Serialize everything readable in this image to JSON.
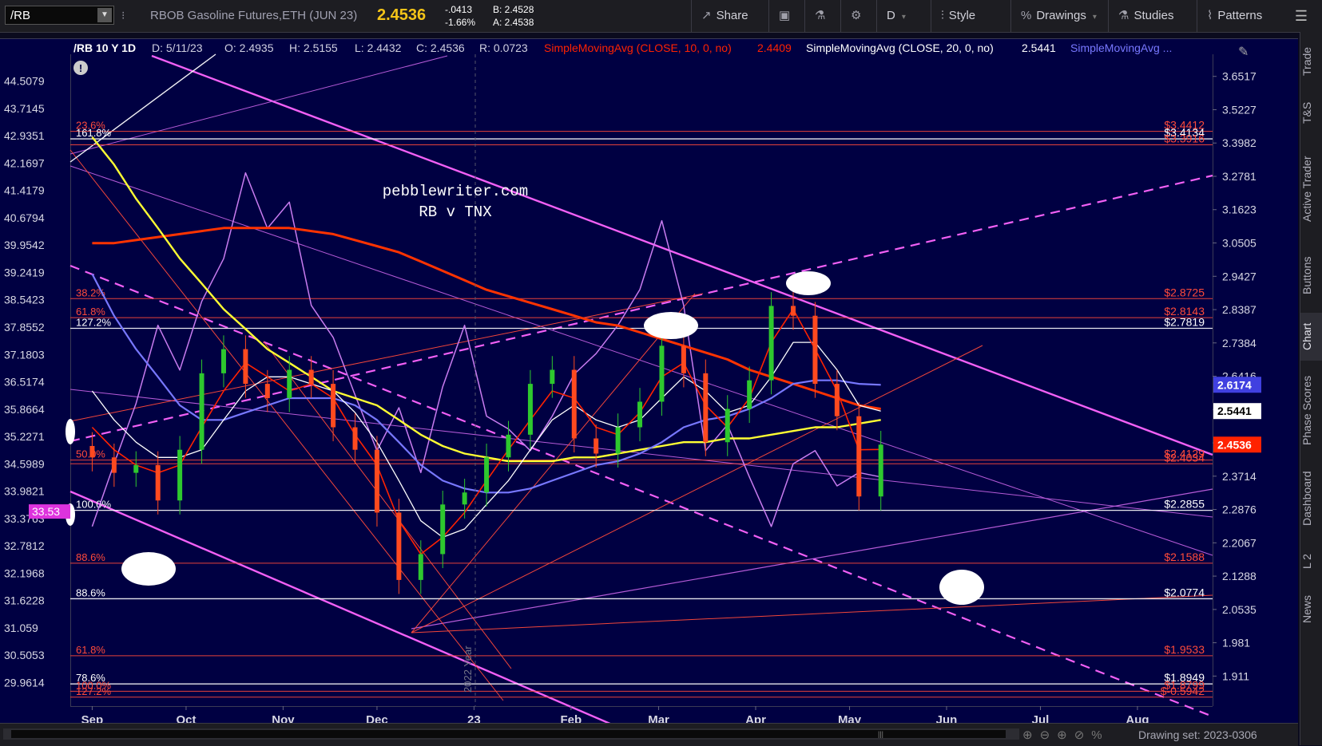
{
  "toolbar": {
    "symbol": "/RB",
    "description": "RBOB Gasoline Futures,ETH (JUN 23)",
    "last": "2.4536",
    "net_change": "-.0413",
    "pct_change": "-1.66%",
    "bid": "B: 2.4528",
    "ask": "A: 2.4538",
    "share": "Share",
    "period": "D",
    "style": "Style",
    "drawings": "Drawings",
    "studies": "Studies",
    "patterns": "Patterns"
  },
  "sidebar": {
    "tabs": [
      "Trade",
      "T&S",
      "Active Trader",
      "Buttons",
      "Chart",
      "Phase Scores",
      "Dashboard",
      "L 2",
      "News"
    ],
    "active": "Chart"
  },
  "bottombar": {
    "drawing_set": "Drawing set: 2023-0306"
  },
  "colors": {
    "background": "#000042",
    "candle_up": "#2ec82e",
    "candle_down": "#ff4a1f",
    "sma10": "#ff2200",
    "sma20": "#ffffff",
    "sma50": "#7878ff",
    "sma100": "#ffff33",
    "sma200": "#ff3300",
    "tnx": "#c87cf0",
    "fib_red": "#ff4a3a",
    "fib_white": "#ffffff",
    "channel": "#ff66ff"
  },
  "chart_data": {
    "type": "line",
    "header": {
      "title": "/RB 10 Y 1D",
      "date": "D: 5/11/23",
      "open": "O: 2.4935",
      "high": "H: 2.5155",
      "low": "L: 2.4432",
      "close": "C: 2.4536",
      "range": "R: 0.0723",
      "sma10_label": "SimpleMovingAvg (CLOSE, 10, 0, no)",
      "sma10_value": "2.4409",
      "sma20_label": "SimpleMovingAvg (CLOSE, 20, 0, no)",
      "sma20_value": "2.5441",
      "sma50_label": "SimpleMovingAvg ..."
    },
    "annotations": [
      "pebblewriter.com",
      "RB v TNX"
    ],
    "x_labels": [
      "Sep",
      "Oct",
      "Nov",
      "Dec",
      "23",
      "Feb",
      "Mar",
      "Apr",
      "May",
      "Jun",
      "Jul",
      "Aug"
    ],
    "year_marker": "2022 Year",
    "right_axis": {
      "ylim": [
        1.85,
        3.74
      ],
      "ticks": [
        "3.6517",
        "3.5227",
        "3.3982",
        "3.2781",
        "3.1623",
        "3.0505",
        "2.9427",
        "2.8387",
        "2.7384",
        "2.6416",
        "2.5483",
        "2.4583",
        "2.3714",
        "2.2876",
        "2.2067",
        "2.1288",
        "2.0535",
        "1.981",
        "1.911"
      ],
      "badges": [
        {
          "value": "2.6174",
          "color": "#4040e0"
        },
        {
          "value": "2.5441",
          "color": "#ffffff"
        },
        {
          "value": "2.4536",
          "color": "#ff2200"
        }
      ]
    },
    "left_axis": {
      "ylim": [
        29.5,
        45.3
      ],
      "ticks": [
        "44.5079",
        "43.7145",
        "42.9351",
        "42.1697",
        "41.4179",
        "40.6794",
        "39.9542",
        "39.2419",
        "38.5423",
        "37.8552",
        "37.1803",
        "36.5174",
        "35.8664",
        "35.2271",
        "34.5989",
        "33.9821",
        "33.3763",
        "32.7812",
        "32.1968",
        "31.6228",
        "31.059",
        "30.5053",
        "29.9614"
      ],
      "badge": "33.53"
    },
    "fib_levels": [
      {
        "value": 3.4412,
        "label": "$3.4412",
        "side_label": "23.6%",
        "color": "red"
      },
      {
        "value": 3.4134,
        "label": "$3.4134",
        "side_label": "161.8%",
        "color": "white"
      },
      {
        "value": 3.3916,
        "label": "$3.3916",
        "side_label": "",
        "color": "red"
      },
      {
        "value": 2.8725,
        "label": "$2.8725",
        "side_label": "38.2%",
        "color": "red"
      },
      {
        "value": 2.8143,
        "label": "$2.8143",
        "side_label": "61.8%",
        "color": "red"
      },
      {
        "value": 2.7819,
        "label": "$2.7819",
        "side_label": "127.2%",
        "color": "white"
      },
      {
        "value": 2.4129,
        "label": "$2.4129",
        "side_label": "50.0%",
        "color": "red"
      },
      {
        "value": 2.4034,
        "label": "$2.4034",
        "side_label": "",
        "color": "red"
      },
      {
        "value": 2.2855,
        "label": "$2.2855",
        "side_label": "100.0%",
        "color": "white"
      },
      {
        "value": 2.1588,
        "label": "$2.1588",
        "side_label": "88.6%",
        "color": "red"
      },
      {
        "value": 2.0774,
        "label": "$2.0774",
        "side_label": "88.6%",
        "color": "white"
      },
      {
        "value": 1.9533,
        "label": "$1.9533",
        "side_label": "61.8%",
        "color": "red"
      },
      {
        "value": 1.8949,
        "label": "$1.8949",
        "side_label": "78.6%",
        "color": "white"
      },
      {
        "value": 1.8799,
        "label": "$1.8799",
        "side_label": "100.0%",
        "color": "red"
      },
      {
        "value": 1.868,
        "label": "$-0.5942",
        "side_label": "127.2%",
        "color": "red"
      }
    ],
    "series": [
      {
        "name": "/RB",
        "type": "close",
        "x": [
          "2022-09-01",
          "2022-09-08",
          "2022-09-15",
          "2022-09-22",
          "2022-09-29",
          "2022-10-06",
          "2022-10-13",
          "2022-10-20",
          "2022-10-27",
          "2022-11-03",
          "2022-11-10",
          "2022-11-17",
          "2022-11-24",
          "2022-12-01",
          "2022-12-08",
          "2022-12-15",
          "2022-12-22",
          "2022-12-29",
          "2023-01-05",
          "2023-01-12",
          "2023-01-19",
          "2023-01-26",
          "2023-02-02",
          "2023-02-09",
          "2023-02-16",
          "2023-02-23",
          "2023-03-02",
          "2023-03-09",
          "2023-03-16",
          "2023-03-23",
          "2023-03-30",
          "2023-04-06",
          "2023-04-13",
          "2023-04-20",
          "2023-04-27",
          "2023-05-04",
          "2023-05-11"
        ],
        "y": [
          2.42,
          2.38,
          2.4,
          2.31,
          2.44,
          2.65,
          2.72,
          2.62,
          2.58,
          2.66,
          2.62,
          2.5,
          2.44,
          2.28,
          2.12,
          2.18,
          2.3,
          2.33,
          2.42,
          2.48,
          2.62,
          2.66,
          2.47,
          2.43,
          2.5,
          2.57,
          2.73,
          2.65,
          2.46,
          2.55,
          2.63,
          2.85,
          2.82,
          2.62,
          2.53,
          2.32,
          2.4536
        ]
      },
      {
        "name": "SMA 10",
        "values": [
          2.5,
          2.44,
          2.4,
          2.38,
          2.4,
          2.5,
          2.6,
          2.68,
          2.64,
          2.6,
          2.62,
          2.58,
          2.48,
          2.4,
          2.26,
          2.18,
          2.22,
          2.28,
          2.36,
          2.44,
          2.52,
          2.6,
          2.58,
          2.5,
          2.48,
          2.54,
          2.64,
          2.68,
          2.56,
          2.5,
          2.58,
          2.74,
          2.84,
          2.72,
          2.6,
          2.44,
          2.4409
        ]
      },
      {
        "name": "SMA 20",
        "values": [
          2.6,
          2.52,
          2.46,
          2.42,
          2.42,
          2.44,
          2.52,
          2.6,
          2.64,
          2.64,
          2.62,
          2.6,
          2.54,
          2.46,
          2.36,
          2.26,
          2.22,
          2.24,
          2.3,
          2.36,
          2.44,
          2.52,
          2.56,
          2.52,
          2.5,
          2.52,
          2.58,
          2.64,
          2.6,
          2.54,
          2.56,
          2.64,
          2.74,
          2.74,
          2.66,
          2.56,
          2.5441
        ]
      },
      {
        "name": "SMA 50",
        "values": [
          2.95,
          2.82,
          2.72,
          2.64,
          2.56,
          2.52,
          2.52,
          2.54,
          2.56,
          2.58,
          2.58,
          2.58,
          2.56,
          2.52,
          2.46,
          2.4,
          2.36,
          2.34,
          2.33,
          2.33,
          2.34,
          2.36,
          2.38,
          2.4,
          2.41,
          2.43,
          2.46,
          2.5,
          2.52,
          2.53,
          2.55,
          2.58,
          2.62,
          2.63,
          2.63,
          2.62,
          2.6174
        ]
      },
      {
        "name": "SMA 100",
        "values": [
          3.42,
          3.32,
          3.2,
          3.1,
          3.0,
          2.92,
          2.84,
          2.78,
          2.72,
          2.68,
          2.64,
          2.6,
          2.58,
          2.56,
          2.52,
          2.48,
          2.45,
          2.43,
          2.42,
          2.41,
          2.41,
          2.41,
          2.42,
          2.42,
          2.43,
          2.44,
          2.45,
          2.46,
          2.46,
          2.47,
          2.47,
          2.48,
          2.49,
          2.5,
          2.5,
          2.51,
          2.52
        ]
      },
      {
        "name": "SMA 200",
        "values": [
          3.05,
          3.05,
          3.06,
          3.07,
          3.08,
          3.09,
          3.1,
          3.1,
          3.1,
          3.1,
          3.09,
          3.08,
          3.06,
          3.04,
          3.02,
          2.99,
          2.96,
          2.93,
          2.9,
          2.88,
          2.86,
          2.84,
          2.82,
          2.8,
          2.79,
          2.77,
          2.75,
          2.73,
          2.71,
          2.69,
          2.66,
          2.64,
          2.62,
          2.6,
          2.58,
          2.56,
          2.55
        ]
      },
      {
        "name": "TNX",
        "values": [
          33.2,
          34.6,
          36.0,
          37.9,
          36.8,
          38.5,
          39.6,
          41.9,
          40.4,
          41.1,
          38.4,
          37.6,
          36.2,
          34.9,
          35.9,
          34.4,
          36.4,
          37.9,
          35.7,
          35.4,
          34.9,
          35.7,
          36.7,
          37.2,
          37.9,
          38.8,
          40.6,
          38.4,
          34.9,
          35.5,
          34.3,
          33.2,
          34.6,
          34.9,
          34.1,
          34.4,
          34.3
        ]
      }
    ]
  }
}
